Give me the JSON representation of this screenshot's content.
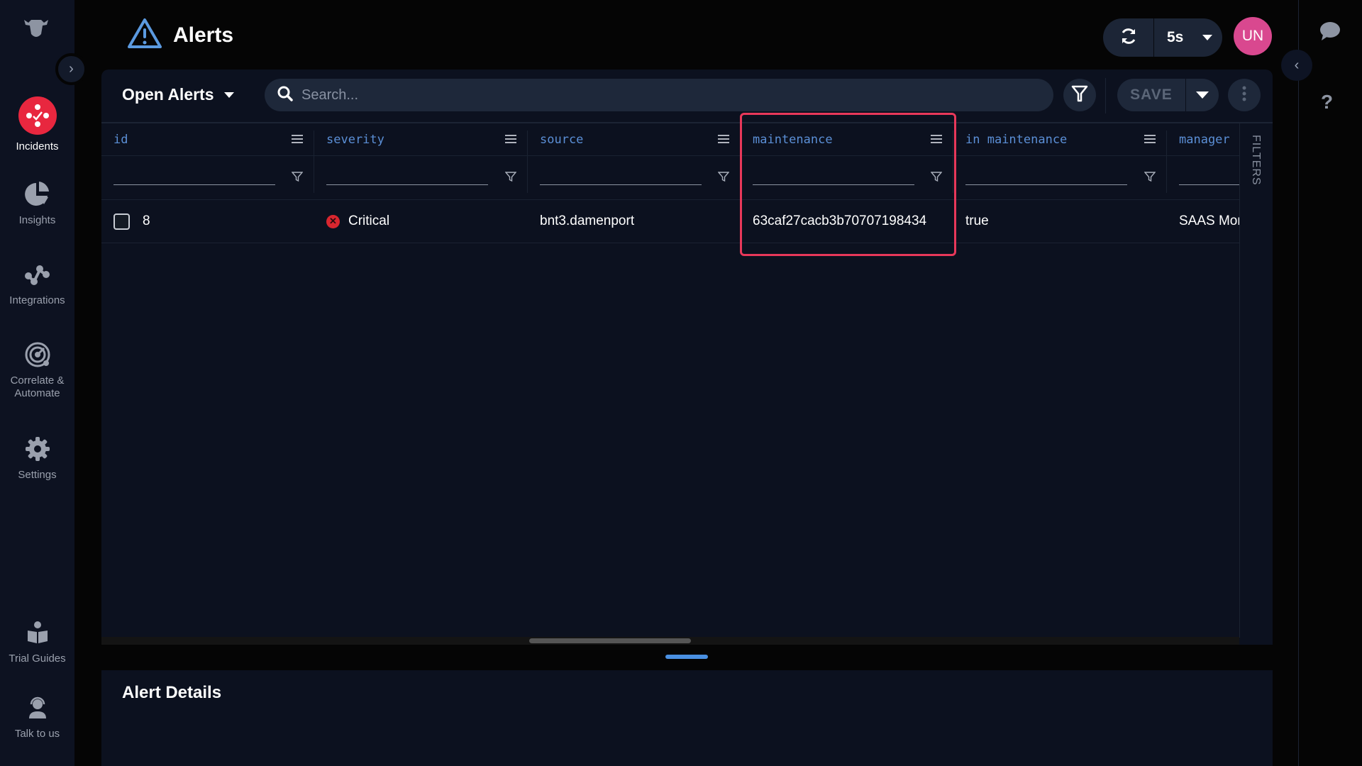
{
  "app": {
    "page_title": "Alerts"
  },
  "sidebar": {
    "items": [
      {
        "label": "Incidents",
        "icon": "incidents-icon",
        "active": true
      },
      {
        "label": "Insights",
        "icon": "pie-chart-icon"
      },
      {
        "label": "Integrations",
        "icon": "integrations-icon"
      },
      {
        "label": "Correlate & Automate",
        "icon": "radar-icon"
      },
      {
        "label": "Settings",
        "icon": "gear-icon"
      },
      {
        "label": "Trial Guides",
        "icon": "book-reader-icon"
      },
      {
        "label": "Talk to us",
        "icon": "headset-icon"
      }
    ]
  },
  "header": {
    "refresh_interval": "5s",
    "avatar_initials": "UN"
  },
  "toolbar": {
    "view_name": "Open Alerts",
    "search_placeholder": "Search...",
    "search_value": "",
    "save_label": "SAVE"
  },
  "table": {
    "columns": [
      {
        "key": "id",
        "label": "id"
      },
      {
        "key": "severity",
        "label": "severity"
      },
      {
        "key": "source",
        "label": "source"
      },
      {
        "key": "maintenance",
        "label": "maintenance"
      },
      {
        "key": "in_maintenance",
        "label": "in maintenance"
      },
      {
        "key": "manager",
        "label": "manager"
      }
    ],
    "rows": [
      {
        "id": "8",
        "severity": "Critical",
        "source": "bnt3.damenport",
        "maintenance": "63caf27cacb3b70707198434",
        "in_maintenance": "true",
        "manager": "SAAS Mor"
      }
    ],
    "filters_label": "FILTERS"
  },
  "details": {
    "title": "Alert Details"
  },
  "colors": {
    "accent": "#5b8fd6",
    "critical": "#d9262f",
    "active_nav": "#e8273f",
    "avatar": "#d9488f",
    "highlight": "#e8385a"
  }
}
